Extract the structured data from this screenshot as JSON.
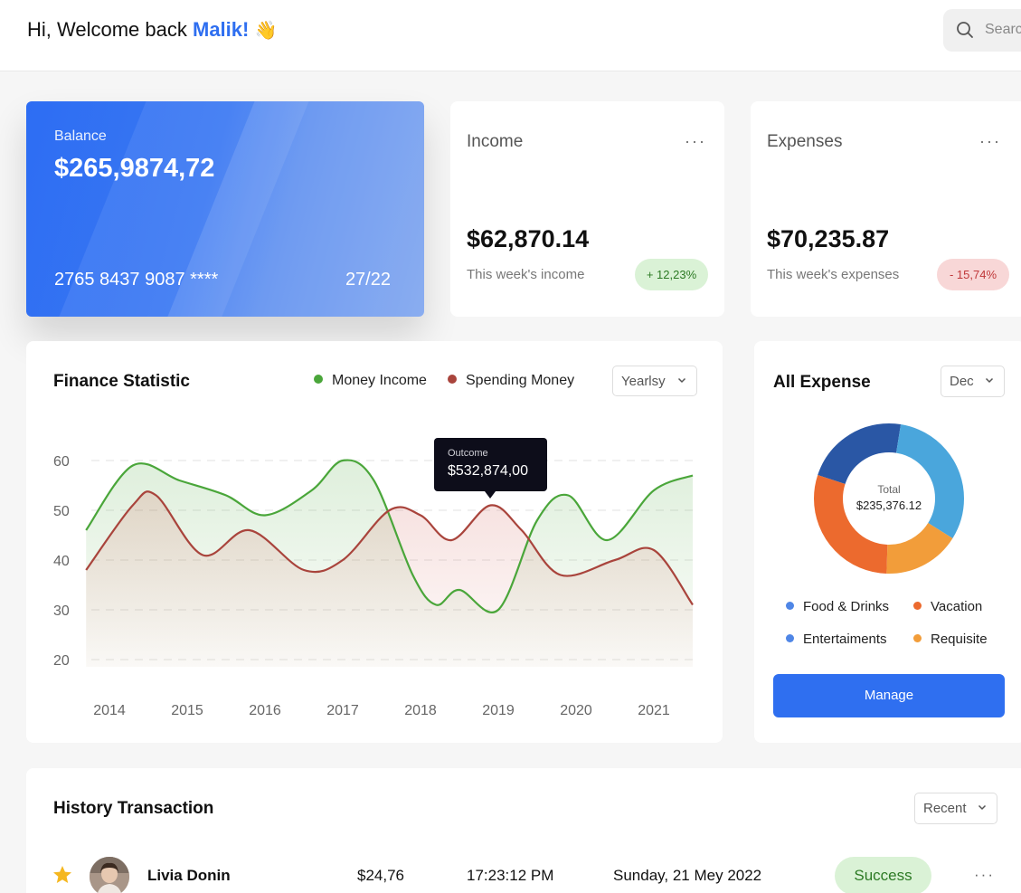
{
  "header": {
    "greeting": "Hi, Welcome back",
    "user_name": "Malik!",
    "wave_emoji": "👋",
    "search_placeholder": "Search"
  },
  "balance_card": {
    "label": "Balance",
    "amount": "$265,9874,72",
    "card_number": "2765 8437 9087 ****",
    "expiry": "27/22"
  },
  "income_card": {
    "title": "Income",
    "menu": "···",
    "amount": "$62,870.14",
    "caption": "This week's income",
    "change": "+ 12,23%"
  },
  "expenses_card": {
    "title": "Expenses",
    "menu": "···",
    "amount": "$70,235.87",
    "caption": "This week's expenses",
    "change": "- 15,74%"
  },
  "finance_statistic": {
    "title": "Finance Statistic",
    "period_select": "Yearlsy",
    "tooltip": {
      "label": "Outcome",
      "value": "$532,874,00"
    }
  },
  "all_expense": {
    "title": "All Expense",
    "month_select": "Dec",
    "total_label": "Total",
    "total_value": "$235,376.12",
    "legend": [
      "Food & Drinks",
      "Vacation",
      "Entertaiments",
      "Requisite"
    ],
    "manage_label": "Manage"
  },
  "history": {
    "title": "History Transaction",
    "filter_select": "Recent",
    "rows": [
      {
        "name": "Livia Donin",
        "amount": "$24,76",
        "time": "17:23:12 PM",
        "date": "Sunday, 21 Mey 2022",
        "status": "Success",
        "more": "···"
      }
    ]
  },
  "colors": {
    "accent": "#2f6ff0",
    "income_line": "#4aa63a",
    "spending_line": "#a9443c",
    "donut": [
      "#2a57a5",
      "#4aa6dc",
      "#f29d3a",
      "#ec6a2e"
    ]
  },
  "chart_data": {
    "type": "area",
    "x": [
      2014,
      2015,
      2016,
      2017,
      2018,
      2019,
      2020,
      2021
    ],
    "ylim": [
      20,
      60
    ],
    "yticks": [
      20,
      30,
      40,
      50,
      60
    ],
    "series": [
      {
        "name": "Money Income",
        "color": "#4aa63a",
        "points": [
          [
            2013.7,
            46
          ],
          [
            2014.3,
            59
          ],
          [
            2014.9,
            56
          ],
          [
            2015.5,
            53
          ],
          [
            2016.0,
            49
          ],
          [
            2016.6,
            54
          ],
          [
            2017.0,
            60
          ],
          [
            2017.4,
            56
          ],
          [
            2017.9,
            37
          ],
          [
            2018.2,
            31
          ],
          [
            2018.5,
            34
          ],
          [
            2019.0,
            30
          ],
          [
            2019.5,
            48
          ],
          [
            2019.9,
            53
          ],
          [
            2020.4,
            44
          ],
          [
            2021.0,
            54
          ],
          [
            2021.5,
            57
          ]
        ]
      },
      {
        "name": "Spending Money",
        "color": "#a9443c",
        "points": [
          [
            2013.7,
            38
          ],
          [
            2014.3,
            51
          ],
          [
            2014.6,
            53
          ],
          [
            2015.2,
            41
          ],
          [
            2015.8,
            46
          ],
          [
            2016.5,
            38
          ],
          [
            2017.0,
            40
          ],
          [
            2017.6,
            50
          ],
          [
            2018.0,
            49
          ],
          [
            2018.4,
            44
          ],
          [
            2018.9,
            51
          ],
          [
            2019.3,
            46
          ],
          [
            2019.8,
            37
          ],
          [
            2020.5,
            40
          ],
          [
            2021.0,
            42
          ],
          [
            2021.5,
            31
          ]
        ]
      }
    ]
  }
}
